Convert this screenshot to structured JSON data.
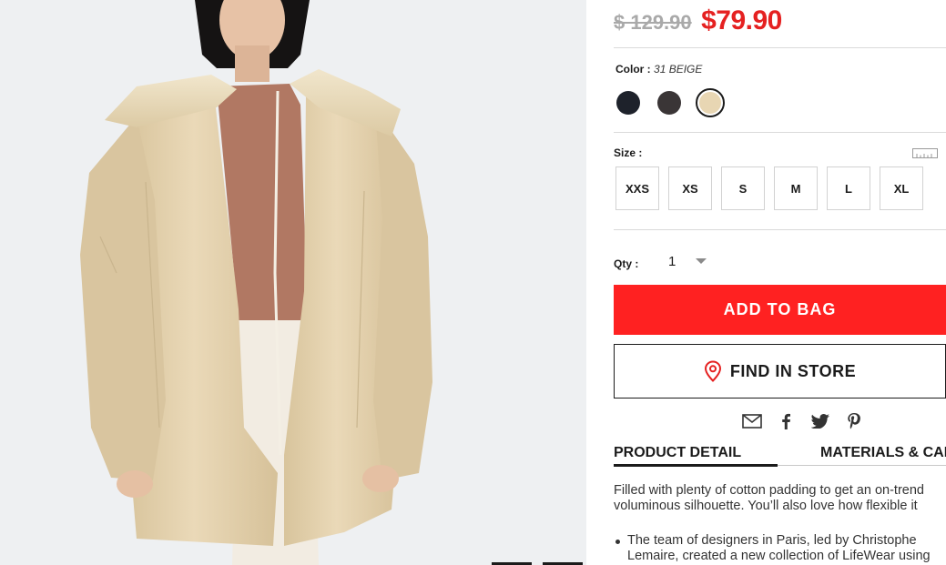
{
  "product": {
    "old_price": "$ 129.90",
    "new_price": "$79.90",
    "color_label": "Color :",
    "color_value": "31 BEIGE",
    "colors": [
      "#1e222b",
      "#3a3536",
      "#e8d6b3"
    ],
    "size_label": "Size :",
    "sizes": [
      "XXS",
      "XS",
      "S",
      "M",
      "L",
      "XL"
    ],
    "qty_label": "Qty :",
    "qty_value": "1",
    "add_to_bag": "ADD TO BAG",
    "find_in_store": "FIND IN STORE",
    "share_icons": [
      "mail-icon",
      "facebook-icon",
      "twitter-icon",
      "pinterest-icon"
    ]
  },
  "tabs": {
    "detail": "PRODUCT DETAIL",
    "materials": "MATERIALS & CARE"
  },
  "description": {
    "line1": "Filled with plenty of cotton padding to get an on-trend",
    "line2": "voluminous silhouette. You’ll also love how flexible it",
    "bullet1_line1": "The team of designers in Paris, led by Christophe",
    "bullet1_line2": "Lemaire, created a new collection of LifeWear using"
  },
  "colors": {
    "accent_red": "#ff2121",
    "sale_red": "#e52121"
  }
}
